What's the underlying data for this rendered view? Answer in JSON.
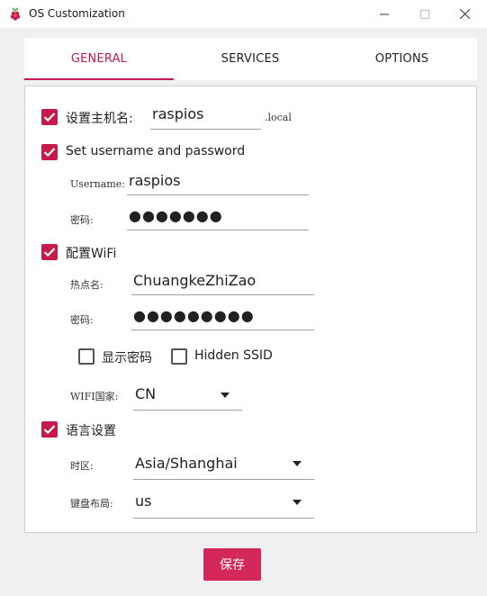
{
  "window": {
    "title": "OS Customization",
    "icon": "raspberry-pi-icon"
  },
  "colors": {
    "accent": "#c51a4a",
    "save_button": "#d4285b"
  },
  "tabs": [
    {
      "label": "GENERAL",
      "selected": true
    },
    {
      "label": "SERVICES",
      "selected": false
    },
    {
      "label": "OPTIONS",
      "selected": false
    }
  ],
  "general": {
    "hostname": {
      "checked": true,
      "label": "设置主机名:",
      "value": "raspios",
      "suffix": ".local"
    },
    "user": {
      "checked": true,
      "label": "Set username and password",
      "username_label": "Username:",
      "username_value": "raspios",
      "password_label": "密码:",
      "password_value": "●●●●●●●"
    },
    "wifi": {
      "checked": true,
      "label": "配置WiFi",
      "ssid_label": "热点名:",
      "ssid_value": "ChuangkeZhiZao",
      "password_label": "密码:",
      "password_value": "●●●●●●●●●",
      "show_password": {
        "checked": false,
        "label": "显示密码"
      },
      "hidden_ssid": {
        "checked": false,
        "label": "Hidden SSID"
      },
      "country_label": "WIFI国家:",
      "country_value": "CN"
    },
    "locale": {
      "checked": true,
      "label": "语言设置",
      "timezone_label": "时区:",
      "timezone_value": "Asia/Shanghai",
      "keyboard_label": "键盘布局:",
      "keyboard_value": "us"
    }
  },
  "footer": {
    "save_label": "保存"
  }
}
